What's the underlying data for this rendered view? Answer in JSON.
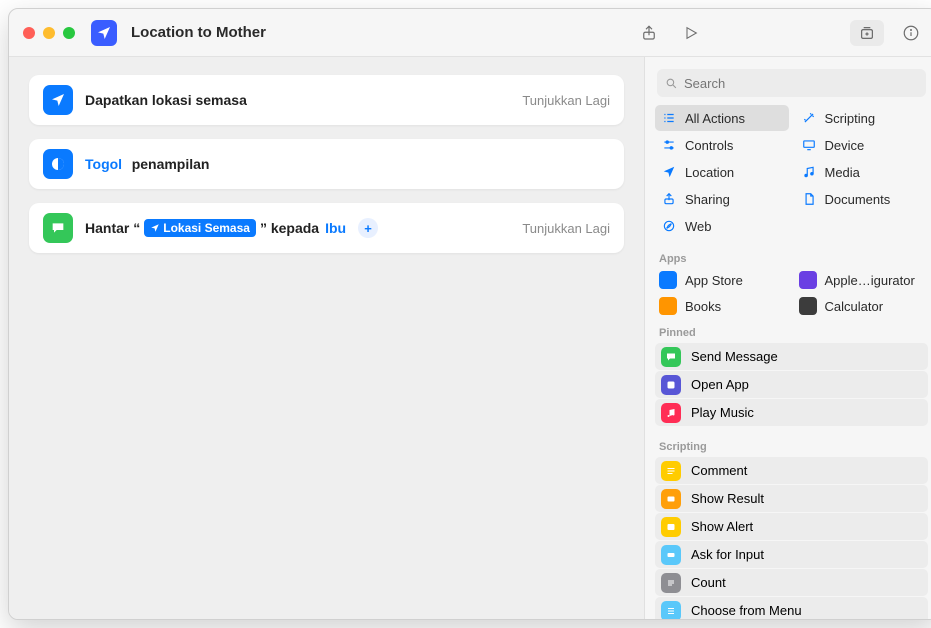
{
  "title": "Location to Mother",
  "search": {
    "placeholder": "Search"
  },
  "actions": {
    "a1": {
      "label": "Dapatkan lokasi semasa",
      "hint": "Tunjukkan Lagi"
    },
    "a2": {
      "token": "Togol",
      "rest": "penampilan"
    },
    "a3": {
      "pre": "Hantar “",
      "chip": "Lokasi Semasa",
      "mid": "” kepada",
      "recipient": "Ibu",
      "hint": "Tunjukkan Lagi"
    }
  },
  "categories": {
    "all": "All Actions",
    "scripting": "Scripting",
    "controls": "Controls",
    "device": "Device",
    "location": "Location",
    "media": "Media",
    "sharing": "Sharing",
    "documents": "Documents",
    "web": "Web"
  },
  "sections": {
    "apps": "Apps",
    "pinned": "Pinned",
    "scripting": "Scripting"
  },
  "apps": {
    "appstore": "App Store",
    "configurator": "Apple…igurator",
    "books": "Books",
    "calculator": "Calculator"
  },
  "pinned": {
    "sendmsg": "Send Message",
    "openapp": "Open App",
    "playmusic": "Play Music"
  },
  "scripting": {
    "comment": "Comment",
    "showresult": "Show Result",
    "showalert": "Show Alert",
    "askinput": "Ask for Input",
    "count": "Count",
    "choose": "Choose from Menu"
  }
}
